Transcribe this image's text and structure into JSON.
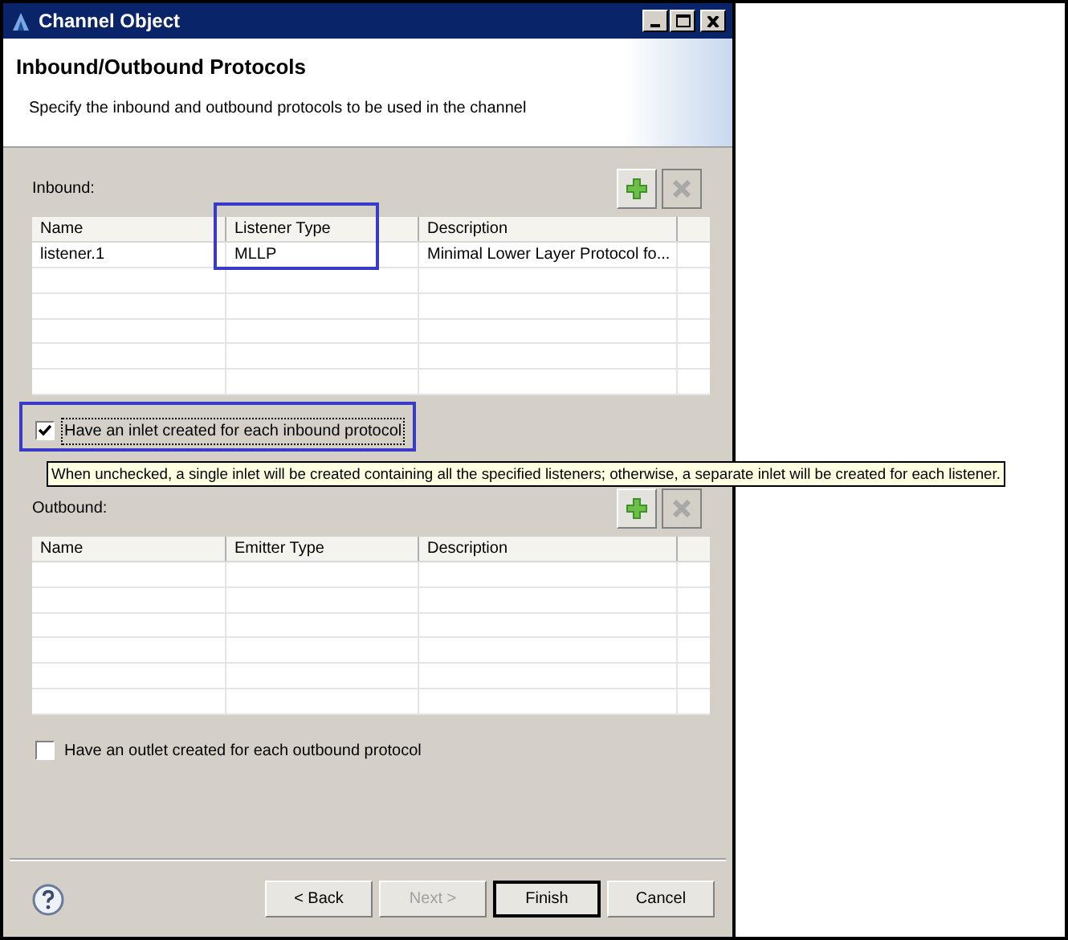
{
  "window": {
    "title": "Channel Object"
  },
  "header": {
    "title": "Inbound/Outbound Protocols",
    "description": "Specify the inbound and outbound protocols to be used in the channel"
  },
  "inbound": {
    "label": "Inbound:",
    "add_disabled": false,
    "remove_disabled": true,
    "columns": [
      {
        "label": "Name",
        "highlighted": false
      },
      {
        "label": "Listener Type",
        "highlighted": true
      },
      {
        "label": "Description",
        "highlighted": false
      }
    ],
    "rows": [
      [
        "listener.1",
        "MLLP",
        "Minimal Lower Layer Protocol fo..."
      ]
    ],
    "checkbox": {
      "label": "Have an inlet created for each inbound protocol",
      "checked": true,
      "focused": true,
      "highlighted": true
    }
  },
  "tooltip": "When unchecked, a single inlet will be created containing all the specified listeners; otherwise, a separate inlet will be created for each listener.",
  "outbound": {
    "label": "Outbound:",
    "add_disabled": false,
    "remove_disabled": true,
    "columns": [
      {
        "label": "Name",
        "highlighted": false
      },
      {
        "label": "Emitter Type",
        "highlighted": false
      },
      {
        "label": "Description",
        "highlighted": false
      }
    ],
    "checkbox": {
      "label": "Have an outlet created for each outbound protocol",
      "checked": false,
      "focused": false,
      "highlighted": false
    }
  },
  "buttons": [
    {
      "label": "< Back",
      "disabled": false,
      "default": false
    },
    {
      "label": "Next >",
      "disabled": true,
      "default": false
    },
    {
      "label": "Finish",
      "disabled": false,
      "default": true
    },
    {
      "label": "Cancel",
      "disabled": false,
      "default": false
    }
  ]
}
